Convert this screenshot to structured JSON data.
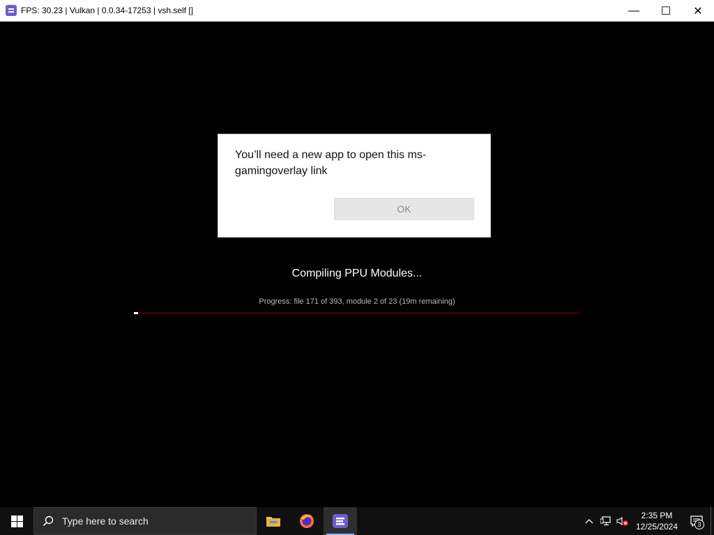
{
  "window": {
    "title": "FPS: 30.23 | Vulkan | 0.0.34-17253 | vsh.self []",
    "app_icon": "rpcs3-icon",
    "minimize_glyph": "—",
    "maximize_glyph": "☐",
    "close_glyph": "✕"
  },
  "dialog": {
    "message": "You’ll need a new app to open this ms-gamingoverlay link",
    "ok_label": "OK"
  },
  "compile": {
    "title": "Compiling PPU Modules...",
    "progress_text": "Progress: file 171 of 393, module 2 of 23 (19m remaining)",
    "progress_fraction": 0.01
  },
  "taskbar": {
    "search_placeholder": "Type here to search",
    "apps": [
      "file-explorer-icon",
      "firefox-icon",
      "rpcs3-icon"
    ],
    "clock_time": "2:35 PM",
    "clock_date": "12/25/2024",
    "notification_count": "3"
  }
}
